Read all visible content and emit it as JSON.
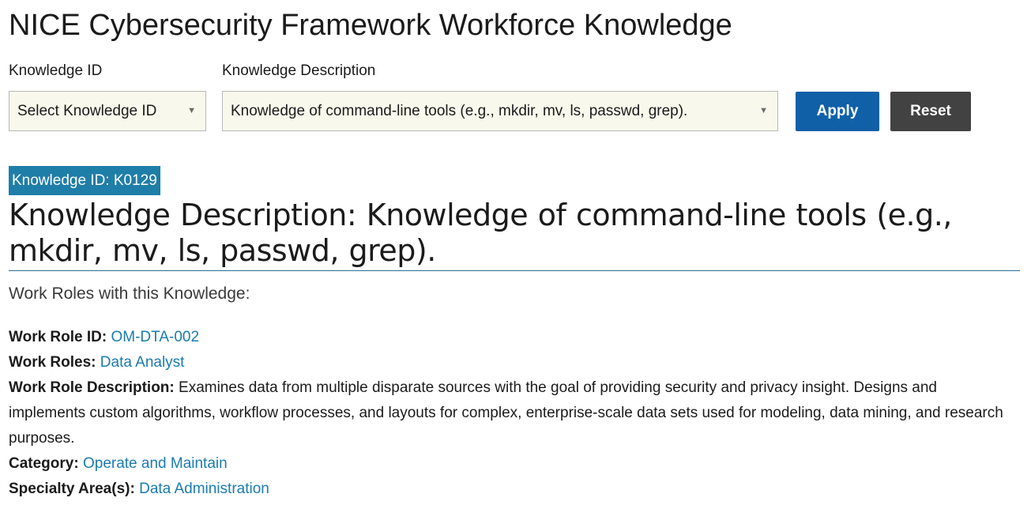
{
  "title": "NICE Cybersecurity Framework Workforce Knowledge",
  "filters": {
    "knowledge_id": {
      "label": "Knowledge ID",
      "selected": "Select Knowledge ID"
    },
    "knowledge_description": {
      "label": "Knowledge Description",
      "selected": "Knowledge of command-line tools (e.g., mkdir, mv, ls, passwd, grep)."
    },
    "apply_label": "Apply",
    "reset_label": "Reset"
  },
  "result": {
    "id_badge": "Knowledge ID: K0129",
    "description_heading": "Knowledge Description: Knowledge of command-line tools (e.g., mkdir, mv, ls, passwd, grep).",
    "work_roles_intro": "Work Roles with this Knowledge:",
    "work_role": {
      "id_label": "Work Role ID:",
      "id_value": "OM-DTA-002",
      "roles_label": "Work Roles:",
      "roles_value": "Data Analyst",
      "description_label": "Work Role Description:",
      "description_value": "Examines data from multiple disparate sources with the goal of providing security and privacy insight. Designs and implements custom algorithms, workflow processes, and layouts for complex, enterprise-scale data sets used for modeling, data mining, and research purposes.",
      "category_label": "Category:",
      "category_value": "Operate and Maintain",
      "specialty_label": "Specialty Area(s):",
      "specialty_value": "Data Administration"
    }
  },
  "colors": {
    "badge_bg": "#1f7ea8",
    "apply_bg": "#1060a8",
    "reset_bg": "#424242",
    "select_bg": "#f8f8ec",
    "link": "#1a7bb0",
    "divider": "#2a6e96"
  },
  "icons": {
    "dropdown_caret": "caret-down-icon"
  }
}
